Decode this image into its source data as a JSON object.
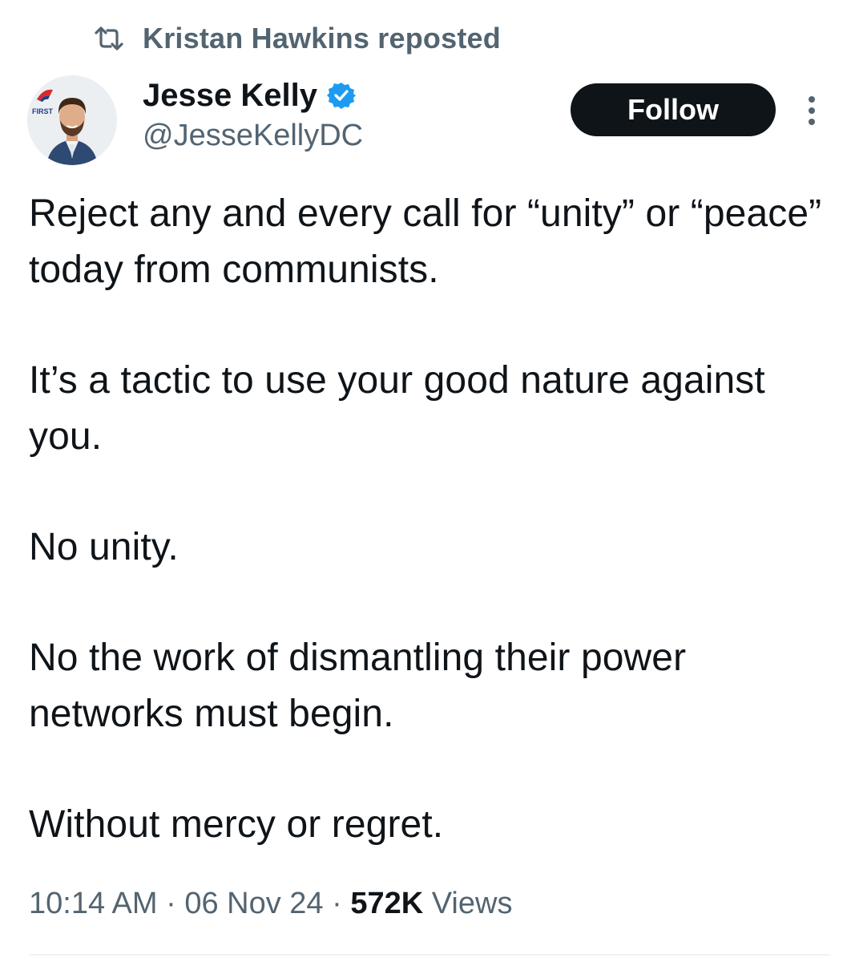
{
  "repost": {
    "label": "Kristan Hawkins reposted",
    "icon": "repost-icon"
  },
  "author": {
    "display_name": "Jesse Kelly",
    "handle": "@JesseKellyDC",
    "verified_icon": "verified-badge-icon",
    "avatar_logo_text": "FIRST"
  },
  "follow_button": {
    "label": "Follow"
  },
  "more_menu": {
    "icon": "more-options-icon"
  },
  "tweet": {
    "paragraphs": [
      "Reject any and every call for “unity” or “peace” today from communists.",
      "It’s a tactic to use your good nature against you.",
      "No unity.",
      "No the work of dismantling their power networks must begin.",
      "Without mercy or regret."
    ]
  },
  "meta": {
    "time": "10:14 AM",
    "separator": "·",
    "date": "06 Nov 24",
    "views_count": "572K",
    "views_label": "Views"
  },
  "colors": {
    "text_primary": "#0f1419",
    "text_secondary": "#536471",
    "verified_blue": "#1d9bf0",
    "follow_bg": "#0f1419",
    "follow_text": "#ffffff"
  }
}
